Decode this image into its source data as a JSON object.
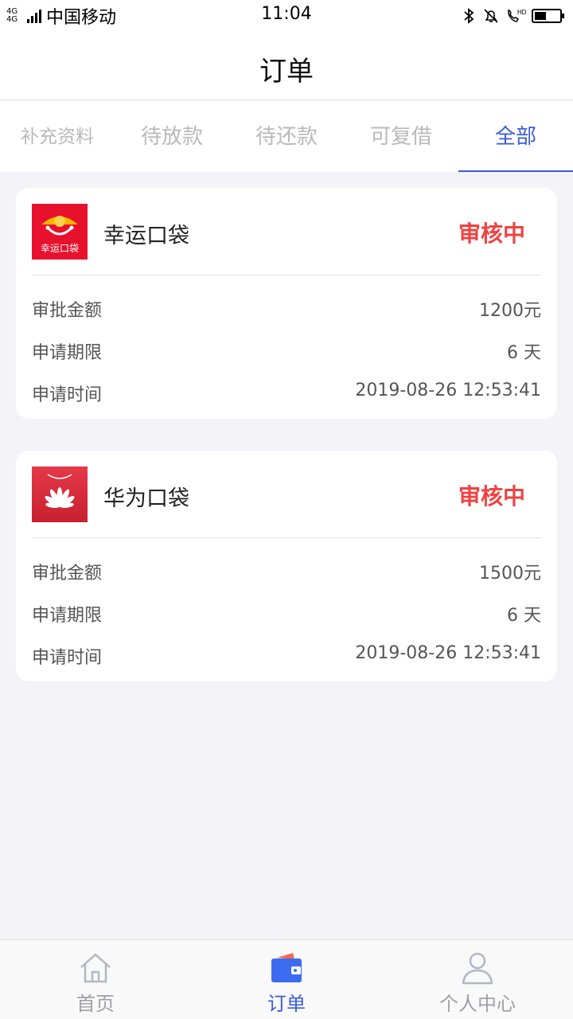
{
  "status_bar": {
    "network_top": "4G",
    "network_bottom": "4G",
    "carrier": "中国移动",
    "time": "11:04",
    "battery_level": 0.45
  },
  "header": {
    "title": "订单"
  },
  "tabs": [
    {
      "label": "补充资料",
      "active": false
    },
    {
      "label": "待放款",
      "active": false
    },
    {
      "label": "待还款",
      "active": false
    },
    {
      "label": "可复借",
      "active": false
    },
    {
      "label": "全部",
      "active": true
    }
  ],
  "orders": [
    {
      "logo_icon": "xingyun-koudai-logo",
      "logo_text": "幸运口袋",
      "name": "幸运口袋",
      "status": "审核中",
      "rows": [
        {
          "label": "审批金额",
          "value": "1200元"
        },
        {
          "label": "申请期限",
          "value": "6 天"
        },
        {
          "label": "申请时间",
          "value": "2019-08-26 12:53:41"
        }
      ]
    },
    {
      "logo_icon": "huawei-koudai-logo",
      "name": "华为口袋",
      "status": "审核中",
      "rows": [
        {
          "label": "审批金额",
          "value": "1500元"
        },
        {
          "label": "申请期限",
          "value": "6 天"
        },
        {
          "label": "申请时间",
          "value": "2019-08-26 12:53:41"
        }
      ]
    }
  ],
  "bottom_nav": [
    {
      "label": "首页",
      "icon": "home-icon",
      "active": false
    },
    {
      "label": "订单",
      "icon": "wallet-icon",
      "active": true
    },
    {
      "label": "个人中心",
      "icon": "user-icon",
      "active": false
    }
  ],
  "colors": {
    "accent": "#3b5bdb",
    "status_red": "#f04141",
    "background": "#f3f3f8"
  }
}
